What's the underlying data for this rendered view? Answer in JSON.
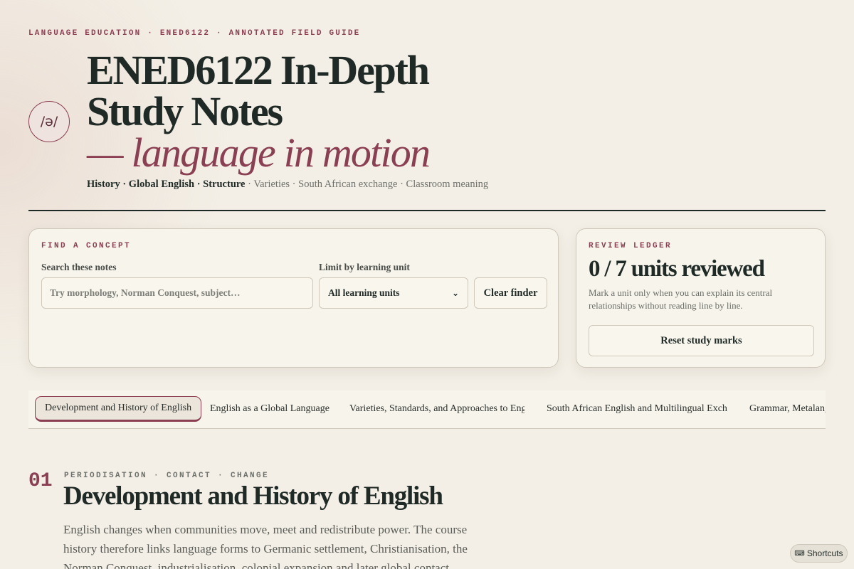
{
  "header": {
    "eyebrow": "LANGUAGE EDUCATION · ENED6122 · ANNOTATED FIELD GUIDE",
    "badge": "/ə/",
    "title": "ENED6122 In-Depth Study Notes",
    "title_accent": "— language in motion",
    "subtitle_bold": "History · Global English · Structure",
    "subtitle_rest": " · Varieties · South African exchange · Classroom meaning"
  },
  "finder": {
    "label": "FIND A CONCEPT",
    "search_label": "Search these notes",
    "search_placeholder": "Try morphology, Norman Conquest, subject…",
    "unit_label": "Limit by learning unit",
    "unit_selected": "All learning units",
    "clear_label": "Clear finder"
  },
  "ledger": {
    "label": "REVIEW LEDGER",
    "count": "0 / 7 units reviewed",
    "description": "Mark a unit only when you can explain its central relationships without reading line by line.",
    "reset_label": "Reset study marks"
  },
  "tabs": [
    {
      "label": "Development and History of English",
      "active": true
    },
    {
      "label": "English as a Global Language",
      "active": false
    },
    {
      "label": "Varieties, Standards, and Approaches to Engl",
      "active": false
    },
    {
      "label": "South African English and Multilingual Excha",
      "active": false
    },
    {
      "label": "Grammar, Metalang",
      "active": false
    }
  ],
  "section": {
    "number": "01",
    "tag": "PERIODISATION · CONTACT · CHANGE",
    "title": "Development and History of English",
    "body": "English changes when communities move, meet and redistribute power. The course history therefore links language forms to Germanic settlement, Christianisation, the Norman Conquest, industrialisation, colonial expansion and later global contact."
  },
  "shortcuts": {
    "icon": "keyboard-icon",
    "label": "Shortcuts"
  }
}
